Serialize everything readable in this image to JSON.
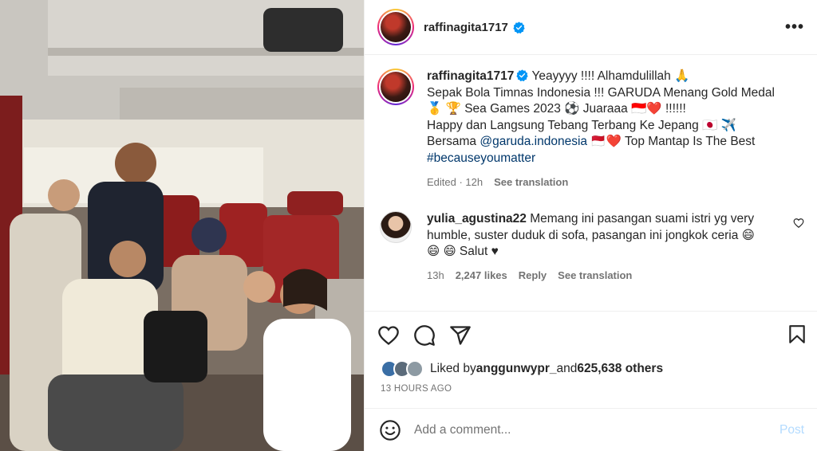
{
  "post": {
    "username": "raffinagita1717",
    "more_label": "•••"
  },
  "caption": {
    "username": "raffinagita1717",
    "line1": " Yeayyyy !!!! Alhamdulillah 🙏",
    "line2": "Sepak Bola Timnas Indonesia !!! GARUDA Menang Gold Medal",
    "line3": "🥇 🏆 Sea Games 2023 ⚽ Juaraaa 🇮🇩❤️ !!!!!!",
    "line4": "Happy dan Langsung Tebang Terbang Ke Jepang 🇯🇵 ✈️",
    "line5_prefix": "Bersama ",
    "line5_mention": "@garuda.indonesia",
    "line5_suffix": " 🇲🇨❤️  Top Mantap Is The Best",
    "hashtag": "#becauseyoumatter",
    "edited": "Edited · 12h",
    "see_translation": "See translation"
  },
  "comment": {
    "username": "yulia_agustina22",
    "text1": " Memang ini pasangan suami istri yg very",
    "text2": "humble, suster duduk di sofa, pasangan ini jongkok ceria 😄",
    "text3": "😄 😄  Salut ♥",
    "time": "13h",
    "likes": "2,247 likes",
    "reply": "Reply",
    "see_translation": "See translation"
  },
  "likes": {
    "prefix": "Liked by ",
    "user": "anggunwypr_",
    "middle": " and ",
    "count": "625,638 others"
  },
  "timestamp": "13 HOURS AGO",
  "add_comment": {
    "placeholder": "Add a comment...",
    "post_label": "Post"
  },
  "colors": {
    "link": "#00376b",
    "verified": "#0095f6",
    "post_disabled": "#b3dbff",
    "secondary_text": "#737373"
  },
  "icons": [
    "more-icon",
    "verified-icon",
    "heart-icon",
    "comment-icon",
    "share-icon",
    "bookmark-icon",
    "emoji-icon",
    "small-heart-icon"
  ]
}
